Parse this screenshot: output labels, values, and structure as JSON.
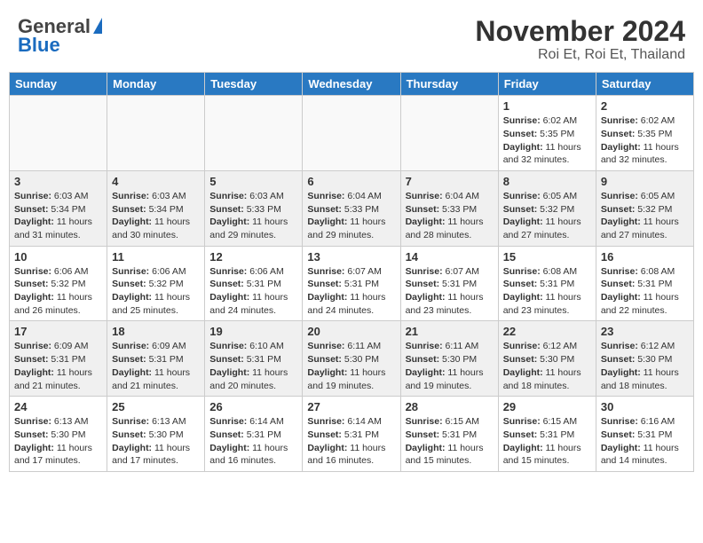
{
  "header": {
    "logo_general": "General",
    "logo_blue": "Blue",
    "title": "November 2024",
    "subtitle": "Roi Et, Roi Et, Thailand"
  },
  "weekdays": [
    "Sunday",
    "Monday",
    "Tuesday",
    "Wednesday",
    "Thursday",
    "Friday",
    "Saturday"
  ],
  "weeks": [
    {
      "alt": false,
      "days": [
        {
          "date": "",
          "empty": true
        },
        {
          "date": "",
          "empty": true
        },
        {
          "date": "",
          "empty": true
        },
        {
          "date": "",
          "empty": true
        },
        {
          "date": "",
          "empty": true
        },
        {
          "date": "1",
          "sunrise": "6:02 AM",
          "sunset": "5:35 PM",
          "daylight": "11 hours and 32 minutes."
        },
        {
          "date": "2",
          "sunrise": "6:02 AM",
          "sunset": "5:35 PM",
          "daylight": "11 hours and 32 minutes."
        }
      ]
    },
    {
      "alt": true,
      "days": [
        {
          "date": "3",
          "sunrise": "6:03 AM",
          "sunset": "5:34 PM",
          "daylight": "11 hours and 31 minutes."
        },
        {
          "date": "4",
          "sunrise": "6:03 AM",
          "sunset": "5:34 PM",
          "daylight": "11 hours and 30 minutes."
        },
        {
          "date": "5",
          "sunrise": "6:03 AM",
          "sunset": "5:33 PM",
          "daylight": "11 hours and 29 minutes."
        },
        {
          "date": "6",
          "sunrise": "6:04 AM",
          "sunset": "5:33 PM",
          "daylight": "11 hours and 29 minutes."
        },
        {
          "date": "7",
          "sunrise": "6:04 AM",
          "sunset": "5:33 PM",
          "daylight": "11 hours and 28 minutes."
        },
        {
          "date": "8",
          "sunrise": "6:05 AM",
          "sunset": "5:32 PM",
          "daylight": "11 hours and 27 minutes."
        },
        {
          "date": "9",
          "sunrise": "6:05 AM",
          "sunset": "5:32 PM",
          "daylight": "11 hours and 27 minutes."
        }
      ]
    },
    {
      "alt": false,
      "days": [
        {
          "date": "10",
          "sunrise": "6:06 AM",
          "sunset": "5:32 PM",
          "daylight": "11 hours and 26 minutes."
        },
        {
          "date": "11",
          "sunrise": "6:06 AM",
          "sunset": "5:32 PM",
          "daylight": "11 hours and 25 minutes."
        },
        {
          "date": "12",
          "sunrise": "6:06 AM",
          "sunset": "5:31 PM",
          "daylight": "11 hours and 24 minutes."
        },
        {
          "date": "13",
          "sunrise": "6:07 AM",
          "sunset": "5:31 PM",
          "daylight": "11 hours and 24 minutes."
        },
        {
          "date": "14",
          "sunrise": "6:07 AM",
          "sunset": "5:31 PM",
          "daylight": "11 hours and 23 minutes."
        },
        {
          "date": "15",
          "sunrise": "6:08 AM",
          "sunset": "5:31 PM",
          "daylight": "11 hours and 23 minutes."
        },
        {
          "date": "16",
          "sunrise": "6:08 AM",
          "sunset": "5:31 PM",
          "daylight": "11 hours and 22 minutes."
        }
      ]
    },
    {
      "alt": true,
      "days": [
        {
          "date": "17",
          "sunrise": "6:09 AM",
          "sunset": "5:31 PM",
          "daylight": "11 hours and 21 minutes."
        },
        {
          "date": "18",
          "sunrise": "6:09 AM",
          "sunset": "5:31 PM",
          "daylight": "11 hours and 21 minutes."
        },
        {
          "date": "19",
          "sunrise": "6:10 AM",
          "sunset": "5:31 PM",
          "daylight": "11 hours and 20 minutes."
        },
        {
          "date": "20",
          "sunrise": "6:11 AM",
          "sunset": "5:30 PM",
          "daylight": "11 hours and 19 minutes."
        },
        {
          "date": "21",
          "sunrise": "6:11 AM",
          "sunset": "5:30 PM",
          "daylight": "11 hours and 19 minutes."
        },
        {
          "date": "22",
          "sunrise": "6:12 AM",
          "sunset": "5:30 PM",
          "daylight": "11 hours and 18 minutes."
        },
        {
          "date": "23",
          "sunrise": "6:12 AM",
          "sunset": "5:30 PM",
          "daylight": "11 hours and 18 minutes."
        }
      ]
    },
    {
      "alt": false,
      "days": [
        {
          "date": "24",
          "sunrise": "6:13 AM",
          "sunset": "5:30 PM",
          "daylight": "11 hours and 17 minutes."
        },
        {
          "date": "25",
          "sunrise": "6:13 AM",
          "sunset": "5:30 PM",
          "daylight": "11 hours and 17 minutes."
        },
        {
          "date": "26",
          "sunrise": "6:14 AM",
          "sunset": "5:31 PM",
          "daylight": "11 hours and 16 minutes."
        },
        {
          "date": "27",
          "sunrise": "6:14 AM",
          "sunset": "5:31 PM",
          "daylight": "11 hours and 16 minutes."
        },
        {
          "date": "28",
          "sunrise": "6:15 AM",
          "sunset": "5:31 PM",
          "daylight": "11 hours and 15 minutes."
        },
        {
          "date": "29",
          "sunrise": "6:15 AM",
          "sunset": "5:31 PM",
          "daylight": "11 hours and 15 minutes."
        },
        {
          "date": "30",
          "sunrise": "6:16 AM",
          "sunset": "5:31 PM",
          "daylight": "11 hours and 14 minutes."
        }
      ]
    }
  ],
  "labels": {
    "sunrise": "Sunrise:",
    "sunset": "Sunset:",
    "daylight": "Daylight:"
  }
}
